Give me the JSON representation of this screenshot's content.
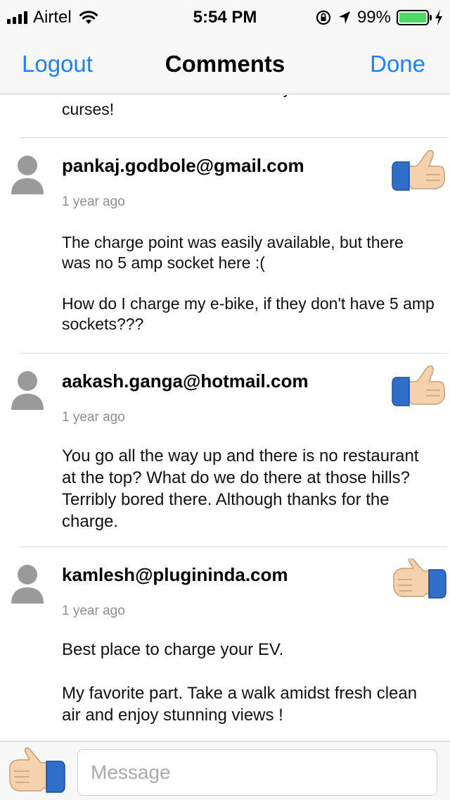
{
  "status_bar": {
    "carrier": "Airtel",
    "time": "5:54 PM",
    "battery_percent": "99%",
    "battery_level": 0.99,
    "icons": [
      "signal-icon",
      "wifi-icon",
      "rotation-lock-icon",
      "location-icon",
      "battery-icon",
      "charging-icon"
    ]
  },
  "nav": {
    "left_label": "Logout",
    "title": "Comments",
    "right_label": "Done",
    "accent": "#1a82fb"
  },
  "partial_comment_text": "reachable and we decided to try out luck.  Well curses!",
  "comments": [
    {
      "author": "pankaj.godbole@gmail.com",
      "time": "1 year ago",
      "vote": "thumbs-down-icon",
      "paragraphs": [
        "The charge point was easily available, but there was no 5 amp socket here :(",
        "How do I charge my e-bike, if they don't have 5 amp sockets???"
      ]
    },
    {
      "author": "aakash.ganga@hotmail.com",
      "time": "1 year ago",
      "vote": "thumbs-down-icon",
      "paragraphs": [
        "You go all the way up and there is no restaurant at the top?  What do we do there at those hills?  Terribly bored there.  Although thanks for the charge."
      ]
    },
    {
      "author": "kamlesh@plugininda.com",
      "time": "1 year ago",
      "vote": "thumbs-up-icon",
      "paragraphs": [
        "Best place to charge your EV.",
        "My favorite part.  Take a walk amidst fresh clean air and enjoy stunning views !"
      ]
    }
  ],
  "bottom_bar": {
    "vote_icon": "thumbs-up-icon",
    "message_placeholder": "Message"
  }
}
